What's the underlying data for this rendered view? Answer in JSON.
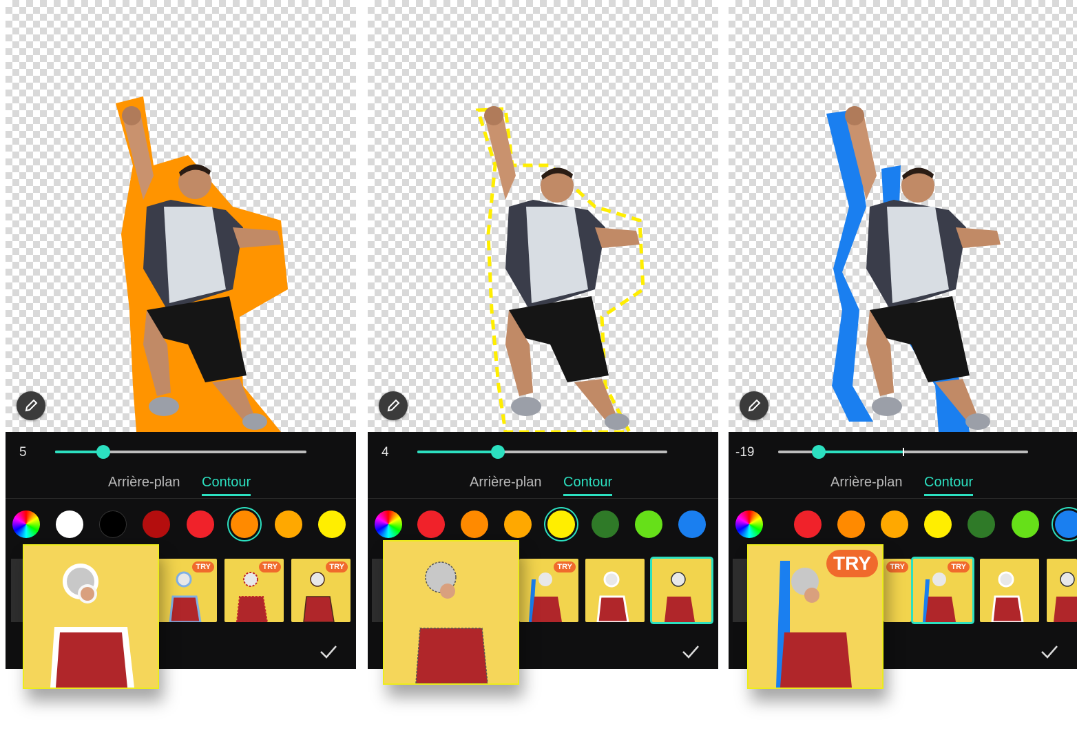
{
  "panels": [
    {
      "slider_value": "5",
      "slider_fraction": 0.19,
      "tabs": {
        "background": "Arrière-plan",
        "outline": "Contour",
        "active": "outline"
      },
      "swatches": [
        {
          "kind": "color-wheel"
        },
        {
          "color": "#ffffff"
        },
        {
          "color": "#000000"
        },
        {
          "color": "#b40e0e"
        },
        {
          "color": "#f0222a"
        },
        {
          "color": "#ff8a00",
          "selected": true
        },
        {
          "color": "#ffa800"
        },
        {
          "color": "#ffee00"
        }
      ],
      "thumb_badges": [
        "TRY",
        "TRY",
        "TRY"
      ],
      "confirm_icon": "check-icon",
      "outline_color": "#ff9400",
      "outline_style": "solid"
    },
    {
      "slider_value": "4",
      "slider_fraction": 0.32,
      "tabs": {
        "background": "Arrière-plan",
        "outline": "Contour",
        "active": "outline"
      },
      "swatches": [
        {
          "kind": "color-wheel"
        },
        {
          "color": "#f0222a"
        },
        {
          "color": "#ff8a00"
        },
        {
          "color": "#ffa800"
        },
        {
          "color": "#ffee00",
          "selected": true
        },
        {
          "color": "#2f7a28"
        },
        {
          "color": "#66e019"
        },
        {
          "color": "#1a7ff0"
        }
      ],
      "thumb_badges": [
        "TRY"
      ],
      "confirm_icon": "check-icon",
      "outline_color": "#ffee00",
      "outline_style": "dashed"
    },
    {
      "slider_value": "-19",
      "slider_fraction": 0.16,
      "tabs": {
        "background": "Arrière-plan",
        "outline": "Contour",
        "active": "outline"
      },
      "swatches": [
        {
          "kind": "color-wheel"
        },
        {
          "color": "#f0222a"
        },
        {
          "color": "#ff8a00"
        },
        {
          "color": "#ffa800"
        },
        {
          "color": "#ffee00"
        },
        {
          "color": "#2f7a28"
        },
        {
          "color": "#66e019"
        },
        {
          "color": "#1a7ff0",
          "selected": true
        }
      ],
      "thumb_badges": [
        "TRY",
        "TRY"
      ],
      "preview_badge": "TRY",
      "confirm_icon": "check-icon",
      "outline_color": "#1a7ff0",
      "outline_style": "offset"
    }
  ],
  "accent_color": "#2ce0c0"
}
